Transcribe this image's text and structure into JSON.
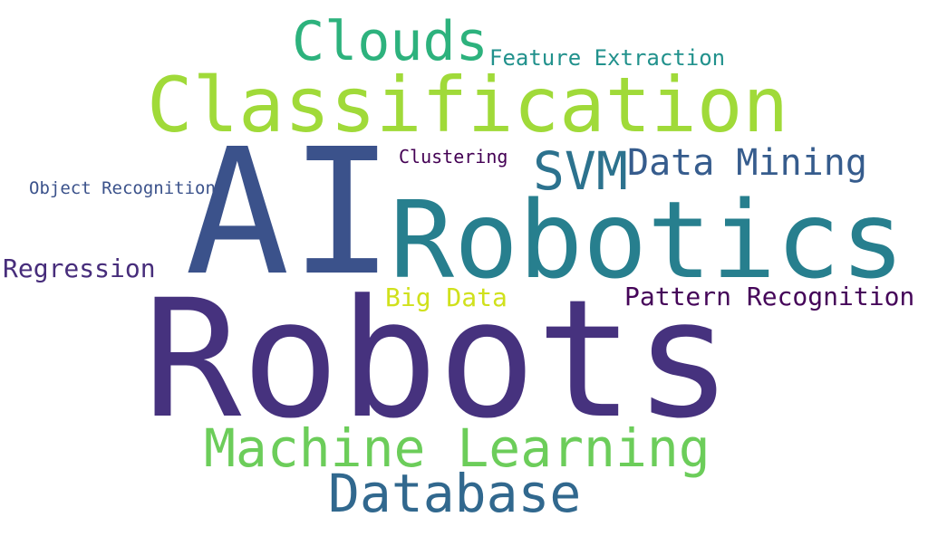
{
  "words": [
    {
      "id": "robots",
      "text": "Robots",
      "color": "#46327e"
    },
    {
      "id": "ai",
      "text": "AI",
      "color": "#3b528b"
    },
    {
      "id": "robotics",
      "text": "Robotics",
      "color": "#277f8e"
    },
    {
      "id": "class",
      "text": "Classification",
      "color": "#a0da39"
    },
    {
      "id": "clouds",
      "text": "Clouds",
      "color": "#2db27d"
    },
    {
      "id": "featext",
      "text": "Feature Extraction",
      "color": "#21918c"
    },
    {
      "id": "svm",
      "text": "SVM",
      "color": "#2c728e"
    },
    {
      "id": "datamining",
      "text": "Data Mining",
      "color": "#365c8d"
    },
    {
      "id": "clustering",
      "text": "Clustering",
      "color": "#440154"
    },
    {
      "id": "objrec",
      "text": "Object Recognition",
      "color": "#3b528b"
    },
    {
      "id": "regression",
      "text": "Regression",
      "color": "#472d7b"
    },
    {
      "id": "bigdata",
      "text": "Big Data",
      "color": "#d0e11c"
    },
    {
      "id": "patrec",
      "text": "Pattern Recognition",
      "color": "#450559"
    },
    {
      "id": "ml",
      "text": "Machine Learning",
      "color": "#6ccd5a"
    },
    {
      "id": "database",
      "text": "Database",
      "color": "#31688e"
    }
  ]
}
